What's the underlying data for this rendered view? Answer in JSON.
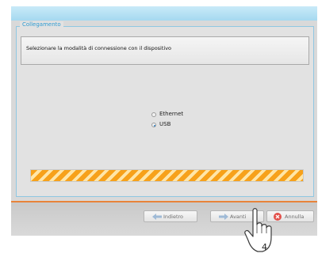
{
  "panel": {
    "legend": "Collegamento",
    "instruction": "Selezionare la modalità di connessione con il dispositivo"
  },
  "options": [
    {
      "label": "Ethernet",
      "selected": false
    },
    {
      "label": "USB",
      "selected": true
    }
  ],
  "buttons": {
    "back_label": "Indietro",
    "next_label": "Avanti",
    "cancel_label": "Annulla"
  },
  "annotation": {
    "step_number": "4"
  },
  "colors": {
    "accent": "#2f9bd1",
    "progress": "#f7a11a",
    "separator": "#e8833a",
    "cancel": "#e2504a"
  }
}
